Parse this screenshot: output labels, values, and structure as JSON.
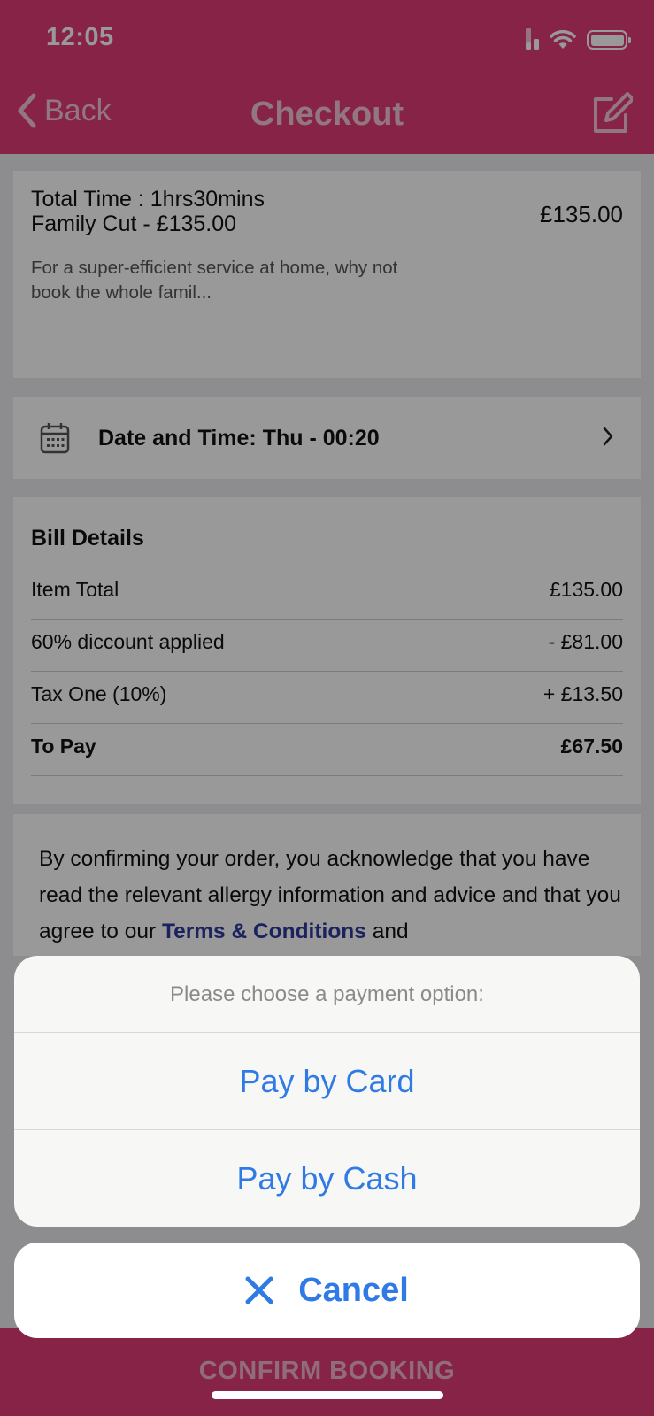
{
  "status_bar": {
    "time": "12:05"
  },
  "nav": {
    "back_label": "Back",
    "title": "Checkout"
  },
  "order": {
    "total_time": "Total Time : 1hrs30mins",
    "item": "Family Cut - £135.00",
    "price": "£135.00",
    "description": "For a super-efficient service at home, why not book the whole famil..."
  },
  "date_time": {
    "label": "Date and Time: Thu - 00:20"
  },
  "bill": {
    "title": "Bill Details",
    "rows": [
      {
        "label": "Item Total",
        "value": "£135.00"
      },
      {
        "label": "60% diccount applied",
        "value": "- £81.00"
      },
      {
        "label": "Tax One (10%)",
        "value": "+ £13.50"
      },
      {
        "label": "To Pay",
        "value": "£67.50"
      }
    ]
  },
  "legal": {
    "text_before": "By confirming your order, you acknowledge that you have read the relevant allergy information and advice and that you agree to our ",
    "link": "Terms & Conditions",
    "text_after": " and"
  },
  "footer": {
    "confirm_label": "CONFIRM BOOKING"
  },
  "action_sheet": {
    "title": "Please choose a payment option:",
    "options": [
      "Pay by Card",
      "Pay by Cash"
    ],
    "cancel_label": "Cancel"
  },
  "colors": {
    "brand": "#e13b76",
    "action_blue": "#2f7ae5",
    "link": "#2f3a9c"
  }
}
